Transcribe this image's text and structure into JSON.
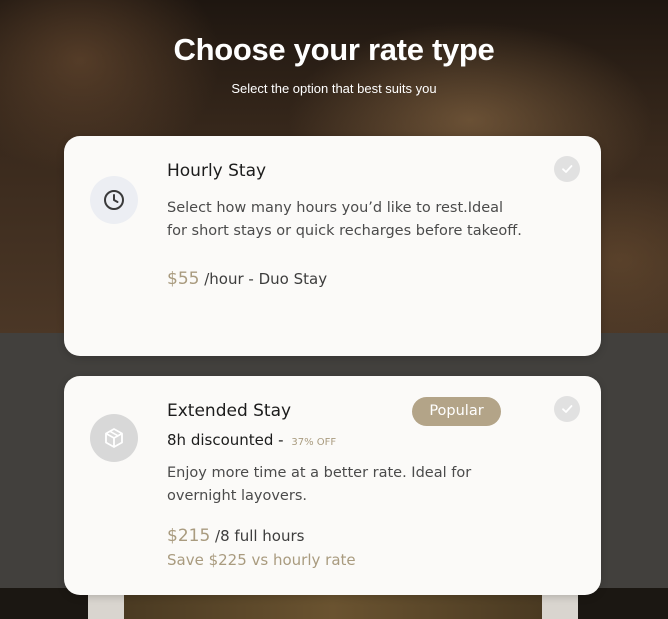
{
  "header": {
    "title": "Choose your rate type",
    "subtitle": "Select the option that best suits you"
  },
  "options": [
    {
      "icon": "clock-icon",
      "title": "Hourly Stay",
      "description": "Select how many hours you’d like to rest.Ideal for short stays or quick recharges before takeoff.",
      "price": "$55",
      "price_unit": "/hour - Duo Stay",
      "selected": false
    },
    {
      "icon": "box-icon",
      "title": "Extended Stay",
      "badge": "Popular",
      "subline": "8h discounted - ",
      "discount": "37% OFF",
      "description": "Enjoy more time at a better rate. Ideal for overnight layovers.",
      "price": "$215",
      "price_unit": "/8 full hours",
      "savings": "Save $225 vs hourly rate",
      "selected": false
    }
  ],
  "colors": {
    "accent": "#a99b7f",
    "badge": "#b3a488",
    "card": "#fbfaf8"
  }
}
